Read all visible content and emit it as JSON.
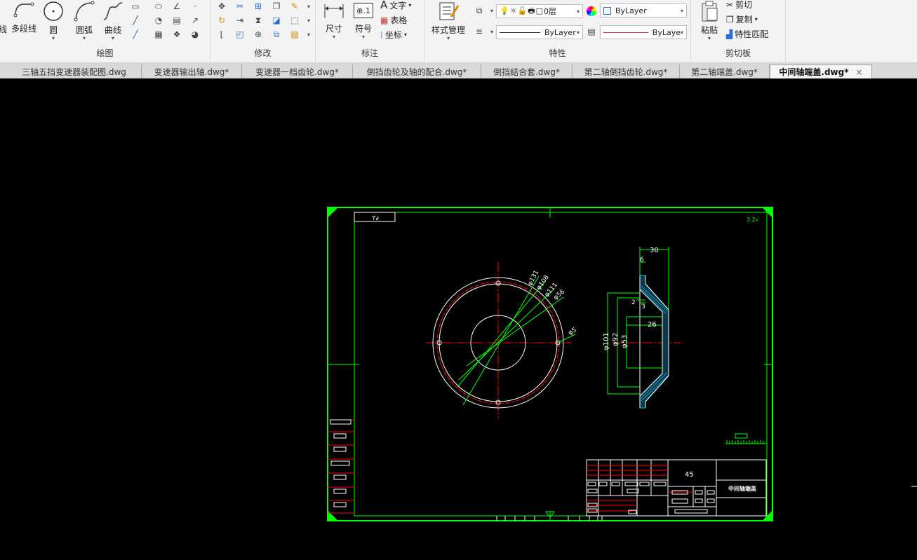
{
  "ribbon": {
    "draw": {
      "title": "绘图",
      "polyline": "多段线",
      "circle": "圆",
      "arc": "圆弧",
      "curve": "曲线",
      "cut_left": "线"
    },
    "modify": {
      "title": "修改"
    },
    "annotate": {
      "title": "标注",
      "dimension": "尺寸",
      "symbol": "符号",
      "text": "文字",
      "table": "表格",
      "coordinate": "坐标",
      "symbol_icon_text": "⊕.1"
    },
    "properties": {
      "title": "特性",
      "style_manager": "样式管理",
      "layer_value": "0层",
      "color_value": "ByLayer",
      "linetype_value": "ByLayer",
      "lineweight_value": "ByLaye"
    },
    "clipboard": {
      "title": "剪切板",
      "paste": "粘贴",
      "cut": "剪切",
      "copy": "复制",
      "match_props": "特性匹配"
    }
  },
  "tabs": [
    {
      "label": "三轴五挡变速器装配图.dwg"
    },
    {
      "label": "变速器输出轴.dwg*"
    },
    {
      "label": "变速器一档齿轮.dwg*"
    },
    {
      "label": "倒挡齿轮及轴的配合.dwg*"
    },
    {
      "label": "倒挡结合套.dwg*"
    },
    {
      "label": "第二轴倒挡齿轮.dwg*"
    },
    {
      "label": "第二轴端盖.dwg*"
    },
    {
      "label": "中间轴端盖.dwg*",
      "close": "×"
    }
  ],
  "drawing": {
    "top_left_label": "ϒ∂",
    "top_right_label": "3.2√",
    "front_view_dims": [
      "φ131",
      "φ108",
      "φ111",
      "φ56",
      "φ5"
    ],
    "side_view_dims": {
      "width": "30",
      "flange": "6",
      "wall": "3",
      "angle": "2",
      "bore_depth": "26",
      "dia_outer": "φ101",
      "dia_mid": "φ92",
      "dia_inner": "φ53"
    },
    "title_block": {
      "material": "45",
      "part_name": "中间轴端盖"
    }
  },
  "colors": {
    "frame": "#00ff00",
    "outline": "#ffffff",
    "center": "#ff0000",
    "dim": "#00ff00",
    "hatch": "#00bfff"
  }
}
